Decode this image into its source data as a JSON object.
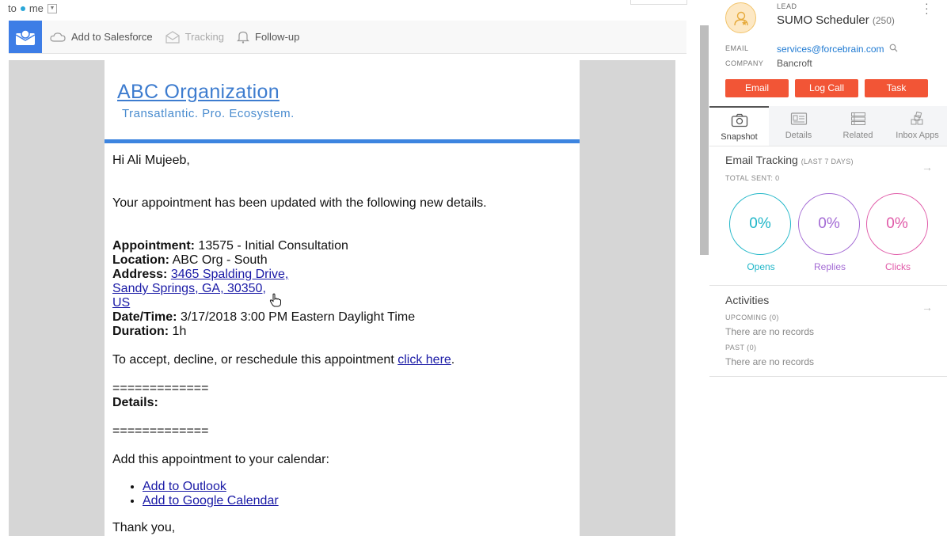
{
  "header": {
    "to_label": "to",
    "recipient": "me"
  },
  "toolbar": {
    "add_salesforce": "Add to Salesforce",
    "tracking": "Tracking",
    "followup": "Follow-up"
  },
  "email": {
    "org_title": "ABC Organization",
    "org_subtitle": "Transatlantic. Pro. Ecosystem.",
    "greeting": "Hi Ali Mujeeb,",
    "intro": "Your appointment has been updated with the following new details.",
    "appointment_label": "Appointment:",
    "appointment_value": " 13575 - Initial Consultation",
    "location_label": "Location:",
    "location_value": " ABC Org - South",
    "address_label": "Address:",
    "address_line1": "3465 Spalding Drive, ",
    "address_line2": "Sandy Springs, GA, 30350, ",
    "address_line3": "US",
    "datetime_label": "Date/Time:",
    "datetime_value": " 3/17/2018 3:00 PM Eastern Daylight Time",
    "duration_label": "Duration:",
    "duration_value": " 1h",
    "accept_text": "To accept, decline, or reschedule this appointment ",
    "accept_link": "click here",
    "accept_end": ".",
    "separator": "=============",
    "details_label": "Details:",
    "calendar_intro": "Add this appointment to your calendar:",
    "cal_links": [
      "Add to Outlook",
      "Add to Google Calendar"
    ],
    "thanks": "Thank you,"
  },
  "side": {
    "tag": "LEAD",
    "name": "SUMO Scheduler",
    "count": "(250)",
    "email_label": "EMAIL",
    "email_value": "services@forcebrain.com",
    "company_label": "COMPANY",
    "company_value": "Bancroft",
    "buttons": [
      "Email",
      "Log Call",
      "Task"
    ],
    "tabs": [
      "Snapshot",
      "Details",
      "Related",
      "Inbox Apps"
    ],
    "tracking_title": "Email Tracking",
    "tracking_period": "(LAST 7 DAYS)",
    "total_sent": "TOTAL SENT: 0",
    "metrics": [
      {
        "value": "0%",
        "label": "Opens",
        "color": "#1fb6c8"
      },
      {
        "value": "0%",
        "label": "Replies",
        "color": "#a36ad4"
      },
      {
        "value": "0%",
        "label": "Clicks",
        "color": "#e05aa8"
      }
    ],
    "activities_title": "Activities",
    "upcoming_label": "UPCOMING (0)",
    "upcoming_empty": "There are no records",
    "past_label": "PAST (0)",
    "past_empty": "There are no records"
  }
}
